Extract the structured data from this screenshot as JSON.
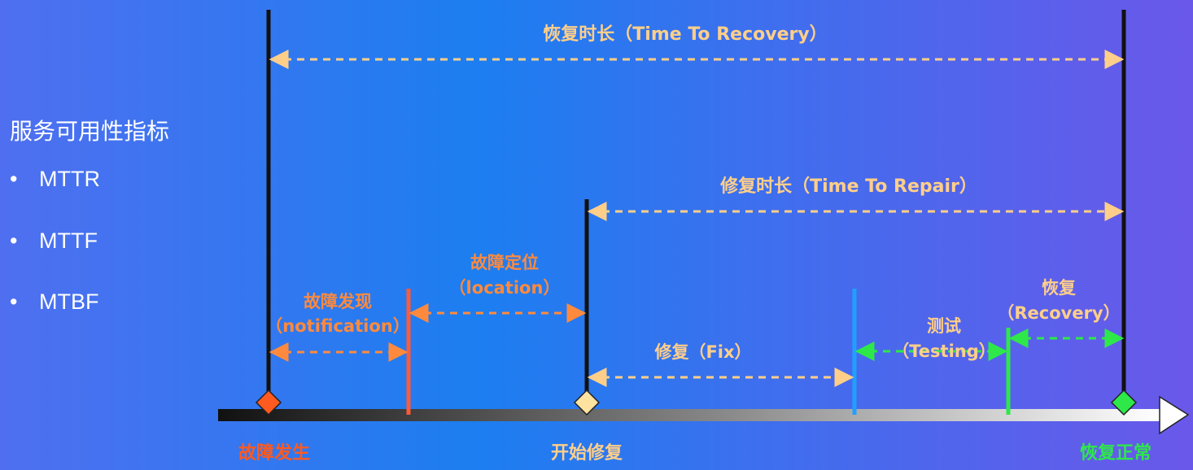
{
  "sidebar": {
    "title": "服务可用性指标",
    "items": [
      {
        "bullet": "•",
        "label": "MTTR"
      },
      {
        "bullet": "•",
        "label": "MTTF"
      },
      {
        "bullet": "•",
        "label": "MTBF"
      }
    ]
  },
  "diagram": {
    "colors": {
      "orange": "#ff8a3d",
      "red_orange": "#ff5a1f",
      "peach": "#ffcf8a",
      "green": "#2ee84a",
      "blue": "#1fa0ff",
      "black": "#111111"
    },
    "labels": {
      "time_to_recovery": "恢复时长（Time To Recovery）",
      "time_to_repair": "修复时长（Time To Repair）",
      "notification_zh": "故障发现",
      "notification_en": "（notification）",
      "location_zh": "故障定位",
      "location_en": "（location）",
      "fix": "修复（Fix）",
      "testing_zh": "测试",
      "testing_en": "（Testing）",
      "recovery_zh": "恢复",
      "recovery_en": "（Recovery）",
      "failure_occurs": "故障发生",
      "start_repair": "开始修复",
      "back_to_normal": "恢复正常"
    }
  }
}
